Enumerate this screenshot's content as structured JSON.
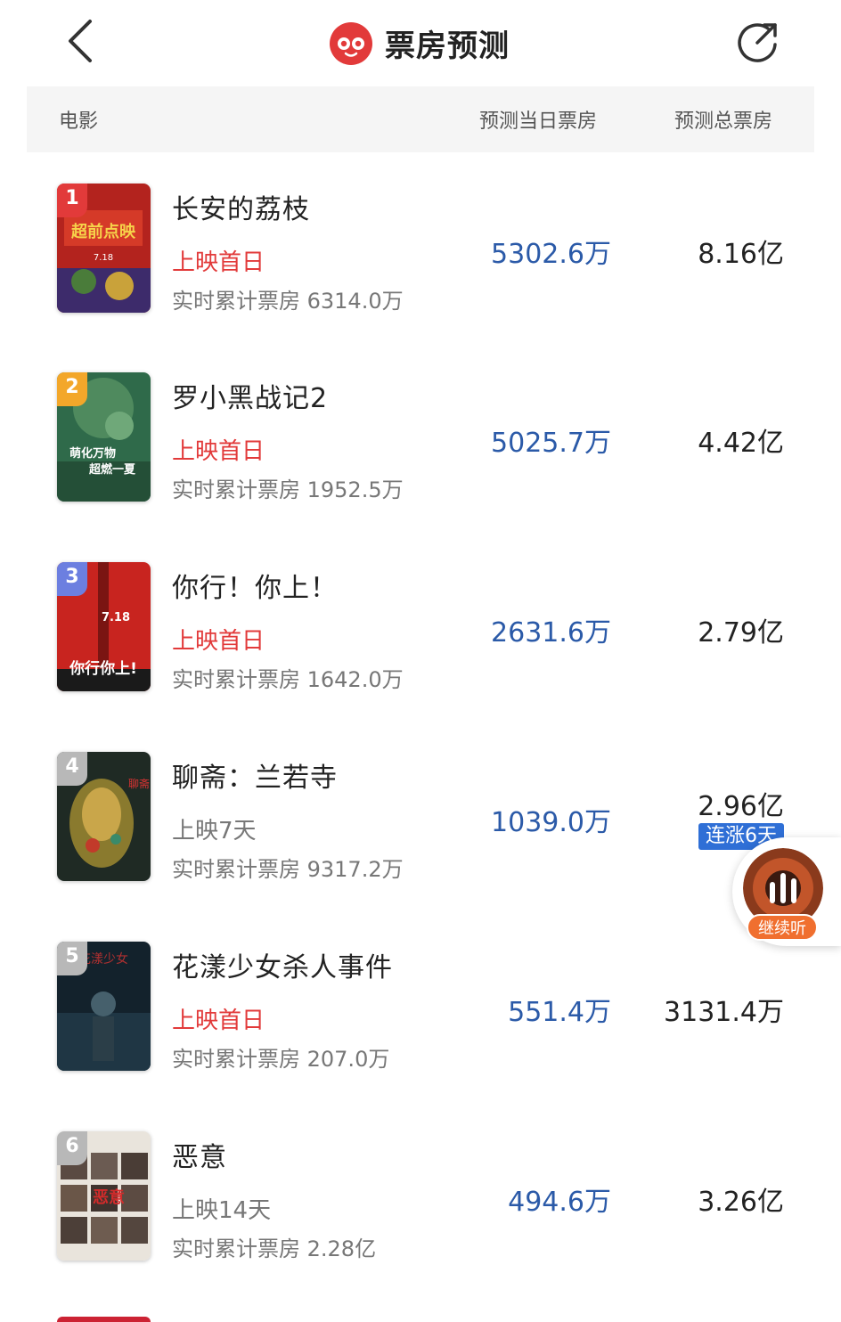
{
  "header": {
    "title": "票房预测",
    "back_icon": "chevron-left-icon",
    "share_icon": "share-icon",
    "logo_icon": "maoyan-cat-logo-icon"
  },
  "columns": {
    "movie": "电影",
    "day_forecast": "预测当日票房",
    "total_forecast": "预测总票房"
  },
  "movies": [
    {
      "rank": "1",
      "name": "长安的荔枝",
      "status": "上映首日",
      "cumulative": "实时累计票房 6314.0万",
      "day": "5302.6万",
      "total": "8.16亿"
    },
    {
      "rank": "2",
      "name": "罗小黑战记2",
      "status": "上映首日",
      "cumulative": "实时累计票房 1952.5万",
      "day": "5025.7万",
      "total": "4.42亿"
    },
    {
      "rank": "3",
      "name": "你行！你上！",
      "status": "上映首日",
      "cumulative": "实时累计票房 1642.0万",
      "day": "2631.6万",
      "total": "2.79亿"
    },
    {
      "rank": "4",
      "name": "聊斋：兰若寺",
      "status": "上映7天",
      "cumulative": "实时累计票房 9317.2万",
      "day": "1039.0万",
      "total": "2.96亿",
      "badge": "连涨6天"
    },
    {
      "rank": "5",
      "name": "花漾少女杀人事件",
      "status": "上映首日",
      "cumulative": "实时累计票房 207.0万",
      "day": "551.4万",
      "total": "3131.4万"
    },
    {
      "rank": "6",
      "name": "恶意",
      "status": "上映14天",
      "cumulative": "实时累计票房 2.28亿",
      "day": "494.6万",
      "total": "3.26亿"
    }
  ],
  "player": {
    "label": "继续听",
    "icon": "audio-bars-icon"
  },
  "colors": {
    "first_day_red": "#e23a3a",
    "day_forecast_blue": "#2b5aa8",
    "streak_badge_blue": "#2f6fd6",
    "rank_gold": "#f3a72a",
    "rank_purple": "#6c7fe0",
    "rank_gray": "#b8b8b8",
    "brand_red": "#e23a3a"
  }
}
